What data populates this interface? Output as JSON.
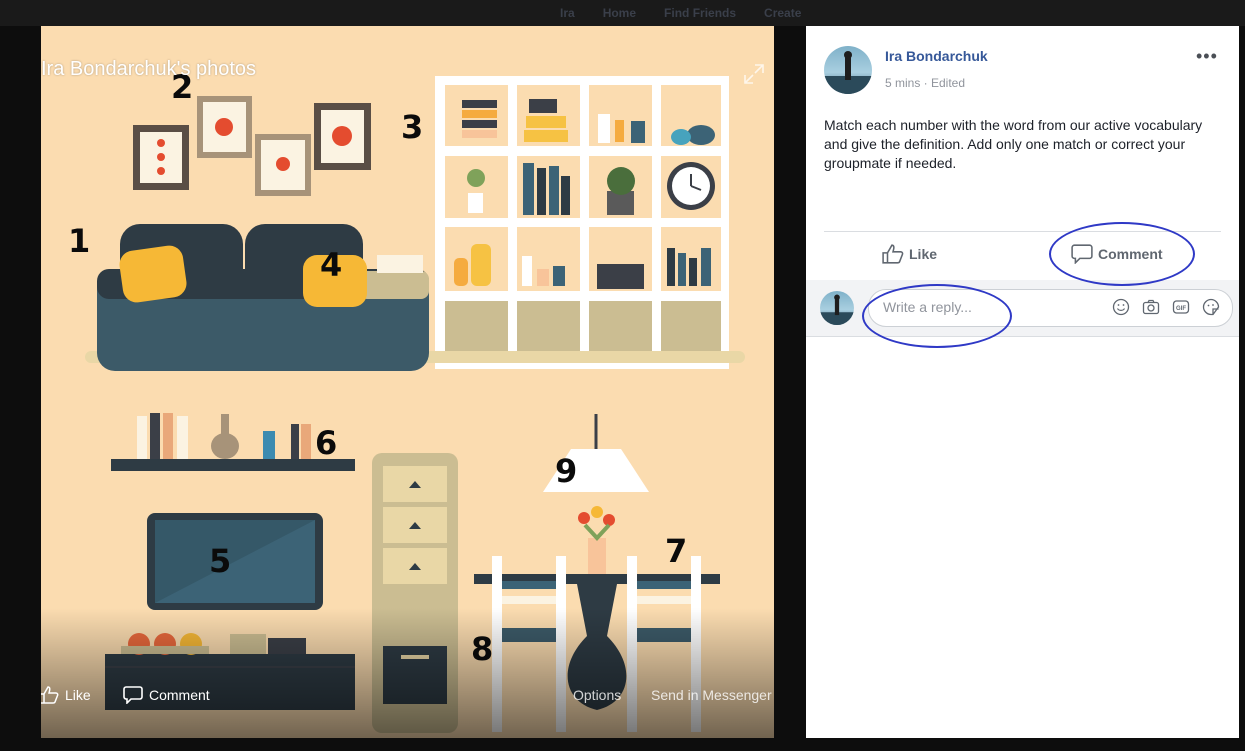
{
  "top_nav": {
    "profile": "Ira",
    "home": "Home",
    "find_friends": "Find Friends",
    "create": "Create"
  },
  "photo": {
    "album_title": "Ira Bondarchuk's photos",
    "numbers": [
      "1",
      "2",
      "3",
      "4",
      "5",
      "6",
      "7",
      "8",
      "9"
    ],
    "actions": {
      "like": "Like",
      "comment": "Comment",
      "options": "Options",
      "send": "Send in Messenger"
    }
  },
  "post": {
    "author": "Ira Bondarchuk",
    "meta": "5 mins · Edited",
    "more": "•••",
    "text": "Match each number with the word from our active vocabulary and give the definition. Add only one match or correct your groupmate if needed.",
    "like_label": "Like",
    "comment_label": "Comment"
  },
  "reply": {
    "placeholder": "Write a reply..."
  },
  "icons": {
    "like": "thumbs-up-icon",
    "comment": "speech-bubble-icon",
    "emoji": "smiley-icon",
    "camera": "camera-icon",
    "gif": "gif-icon",
    "sticker": "sticker-icon",
    "expand": "expand-icon",
    "more": "ellipsis-icon"
  },
  "colors": {
    "link": "#365899",
    "accent": "#2f39c6",
    "photo_bg": "#fbdcb0",
    "background": "#0d0d0d"
  }
}
